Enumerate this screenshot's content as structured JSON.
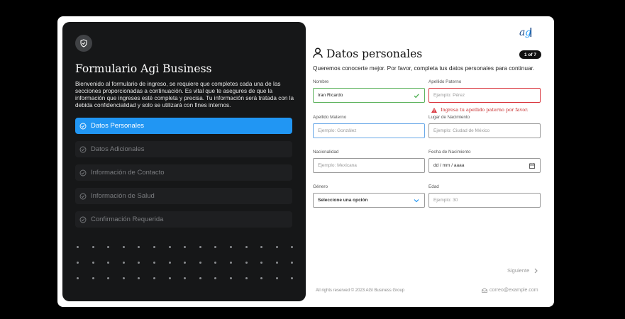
{
  "left_panel": {
    "title": "Formulario Agi Business",
    "description": "Bienvenido al formulario de ingreso, se requiere que completes cada una de las secciones proporcionadas a continuación. Es vital que te asegures de que la información que ingreses esté completa y precisa. Tu información será tratada con la debida confidencialidad y solo se utilizará con fines internos.",
    "steps": [
      {
        "label": "Datos Personales",
        "active": true
      },
      {
        "label": "Datos Adicionales",
        "active": false
      },
      {
        "label": "Información de Contacto",
        "active": false
      },
      {
        "label": "Información de Salud",
        "active": false
      },
      {
        "label": "Confirmación Requerida",
        "active": false
      }
    ]
  },
  "header": {
    "title": "Datos personales",
    "pager": "1 of 7",
    "subtitle": "Queremos conocerte mejor. Por favor, completa tus datos personales para continuar.",
    "logo": "agi-logo"
  },
  "form": {
    "nombre": {
      "label": "Nombre",
      "value": "Iran Ricardo"
    },
    "apellido_paterno": {
      "label": "Apellido Paterno",
      "placeholder": "Ejemplo: Pérez",
      "error": "Ingresa tu apellido paterno por favor."
    },
    "apellido_materno": {
      "label": "Apellido Materno",
      "placeholder": "Ejemplo: González"
    },
    "lugar_nacimiento": {
      "label": "Lugar de Nacimiento",
      "placeholder": "Ejemplo: Ciudad de México"
    },
    "nacionalidad": {
      "label": "Nacionalidad",
      "placeholder": "Ejemplo: Mexicana"
    },
    "fecha_nacimiento": {
      "label": "Fecha de Nacimiento",
      "placeholder": "dd / mm / aaaa"
    },
    "genero": {
      "label": "Género",
      "value": "Seleccione una opción"
    },
    "edad": {
      "label": "Edad",
      "placeholder": "Ejemplo: 30"
    }
  },
  "actions": {
    "next_label": "Siguiente"
  },
  "footer": {
    "copyright": "All rights reserved © 2023 AGI Business Group",
    "email": "correo@example.com"
  },
  "colors": {
    "accent": "#2196f3",
    "error": "#d9363e",
    "success": "#5fb35f",
    "panel": "#161718"
  }
}
